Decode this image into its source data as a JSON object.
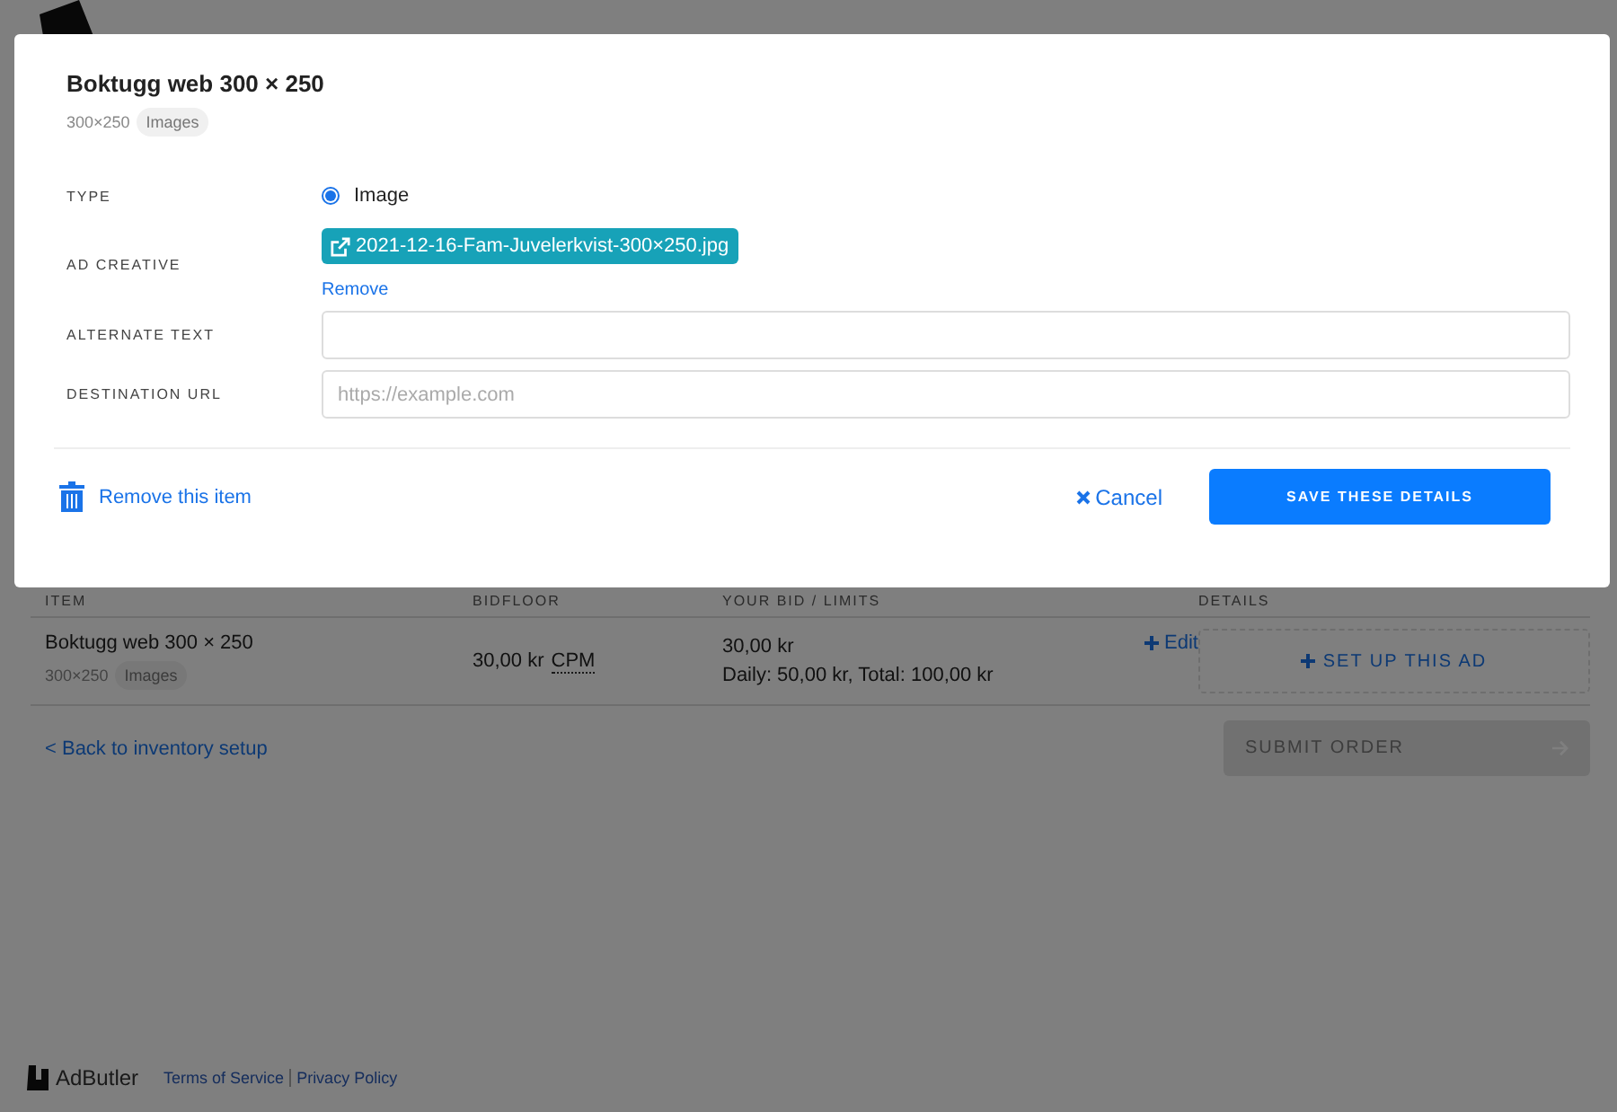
{
  "modal": {
    "title": "Boktugg web 300 × 250",
    "size": "300×250",
    "tag": "Images",
    "fields": [
      {
        "kind": "radio",
        "label": "TYPE",
        "option": "Image",
        "selected": true
      },
      {
        "kind": "file",
        "label": "AD CREATIVE",
        "file": "2021-12-16-Fam-Juvelerkvist-300×250.jpg",
        "link": "Remove"
      },
      {
        "kind": "text",
        "label": "ALTERNATE TEXT"
      },
      {
        "kind": "text",
        "label": "DESTINATION URL",
        "placeholder": "https://example.com"
      }
    ],
    "remove": "Remove this item",
    "cancel": "Cancel",
    "save": "SAVE THESE DETAILS"
  },
  "table": {
    "columns": [
      "ITEM",
      "BIDFLOOR",
      "YOUR BID / LIMITS",
      "DETAILS"
    ],
    "rows": [
      {
        "item": "Boktugg web 300 × 250",
        "size": "300×250",
        "tag": "Images",
        "bidfloor": "30,00 kr",
        "unit": "CPM",
        "bid": "30,00 kr",
        "limits": "Daily: 50,00 kr, Total: 100,00 kr",
        "edit": "Edit",
        "setup": "SET UP THIS AD"
      }
    ]
  },
  "back_link": "< Back to inventory setup",
  "submit": {
    "label": "SUBMIT ORDER",
    "disabled": true
  },
  "footer": {
    "brand": "AdButler",
    "links": [
      "Terms of Service",
      "Privacy Policy"
    ]
  }
}
